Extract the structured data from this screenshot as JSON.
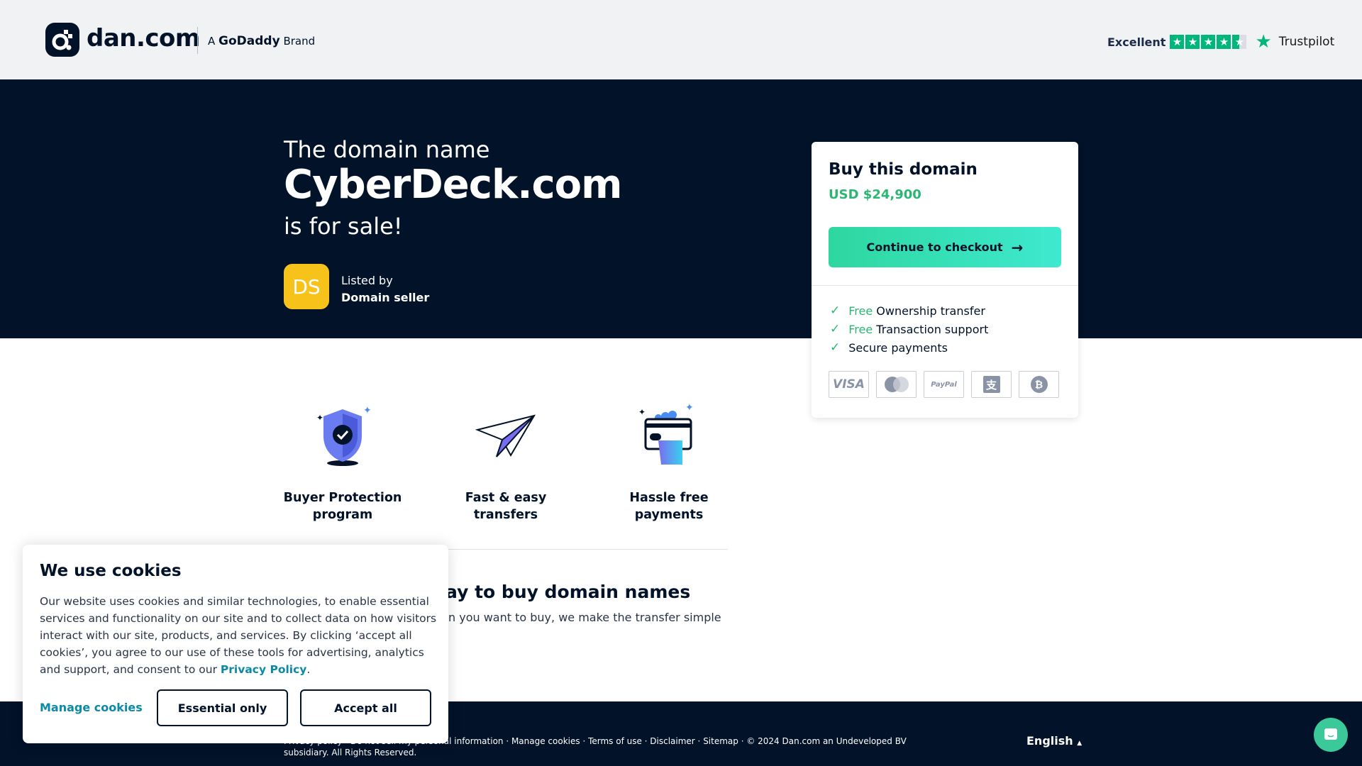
{
  "header": {
    "logo_text": "dan.com",
    "brand_prefix": "A",
    "brand_name": "GoDaddy",
    "brand_suffix": "Brand",
    "trustpilot": {
      "label": "Excellent",
      "rating": 4.5,
      "max": 5,
      "name": "Trustpilot",
      "color": "#00b67a"
    }
  },
  "hero": {
    "pre": "The domain name",
    "domain": "CyberDeck.com",
    "post": "is for sale!",
    "seller": {
      "initials": "DS",
      "listed_by": "Listed by",
      "name": "Domain seller",
      "avatar_color": "#f7c31b"
    }
  },
  "card": {
    "title": "Buy this domain",
    "price": "USD $24,900",
    "checkout": "Continue to checkout",
    "features": [
      {
        "free": "Free",
        "text": "Ownership transfer"
      },
      {
        "free": "Free",
        "text": "Transaction support"
      },
      {
        "free": "",
        "text": "Secure payments"
      }
    ],
    "payments": [
      "VISA",
      "Mastercard",
      "PayPal",
      "Alipay",
      "Bitcoin"
    ],
    "accent": "#2bb673"
  },
  "features": [
    {
      "label": "Buyer Protection program",
      "icon": "shield-check-icon"
    },
    {
      "label": "Fast & easy transfers",
      "icon": "paper-plane-icon"
    },
    {
      "label": "Hassle free payments",
      "icon": "card-hand-icon"
    }
  ],
  "section": {
    "heading": "ay to buy domain names",
    "text": "n you want to buy, we make the transfer simple"
  },
  "footer": {
    "links": "Privacy policy · Do not sell my personal information · Manage cookies · Terms of use · Disclaimer · Sitemap · © 2024 Dan.com an Undeveloped BV subsidiary. All Rights Reserved.",
    "language": "English"
  },
  "cookie": {
    "title": "We use cookies",
    "body": "Our website uses cookies and similar technologies, to enable essential services and functionality on our site and to collect data on how visitors interact with our site, products, and services. By clicking ‘accept all cookies’, you agree to our use of these tools for advertising, analytics and support, and consent to our ",
    "policy_link": "Privacy Policy",
    "manage": "Manage cookies",
    "essential": "Essential only",
    "accept": "Accept all"
  }
}
